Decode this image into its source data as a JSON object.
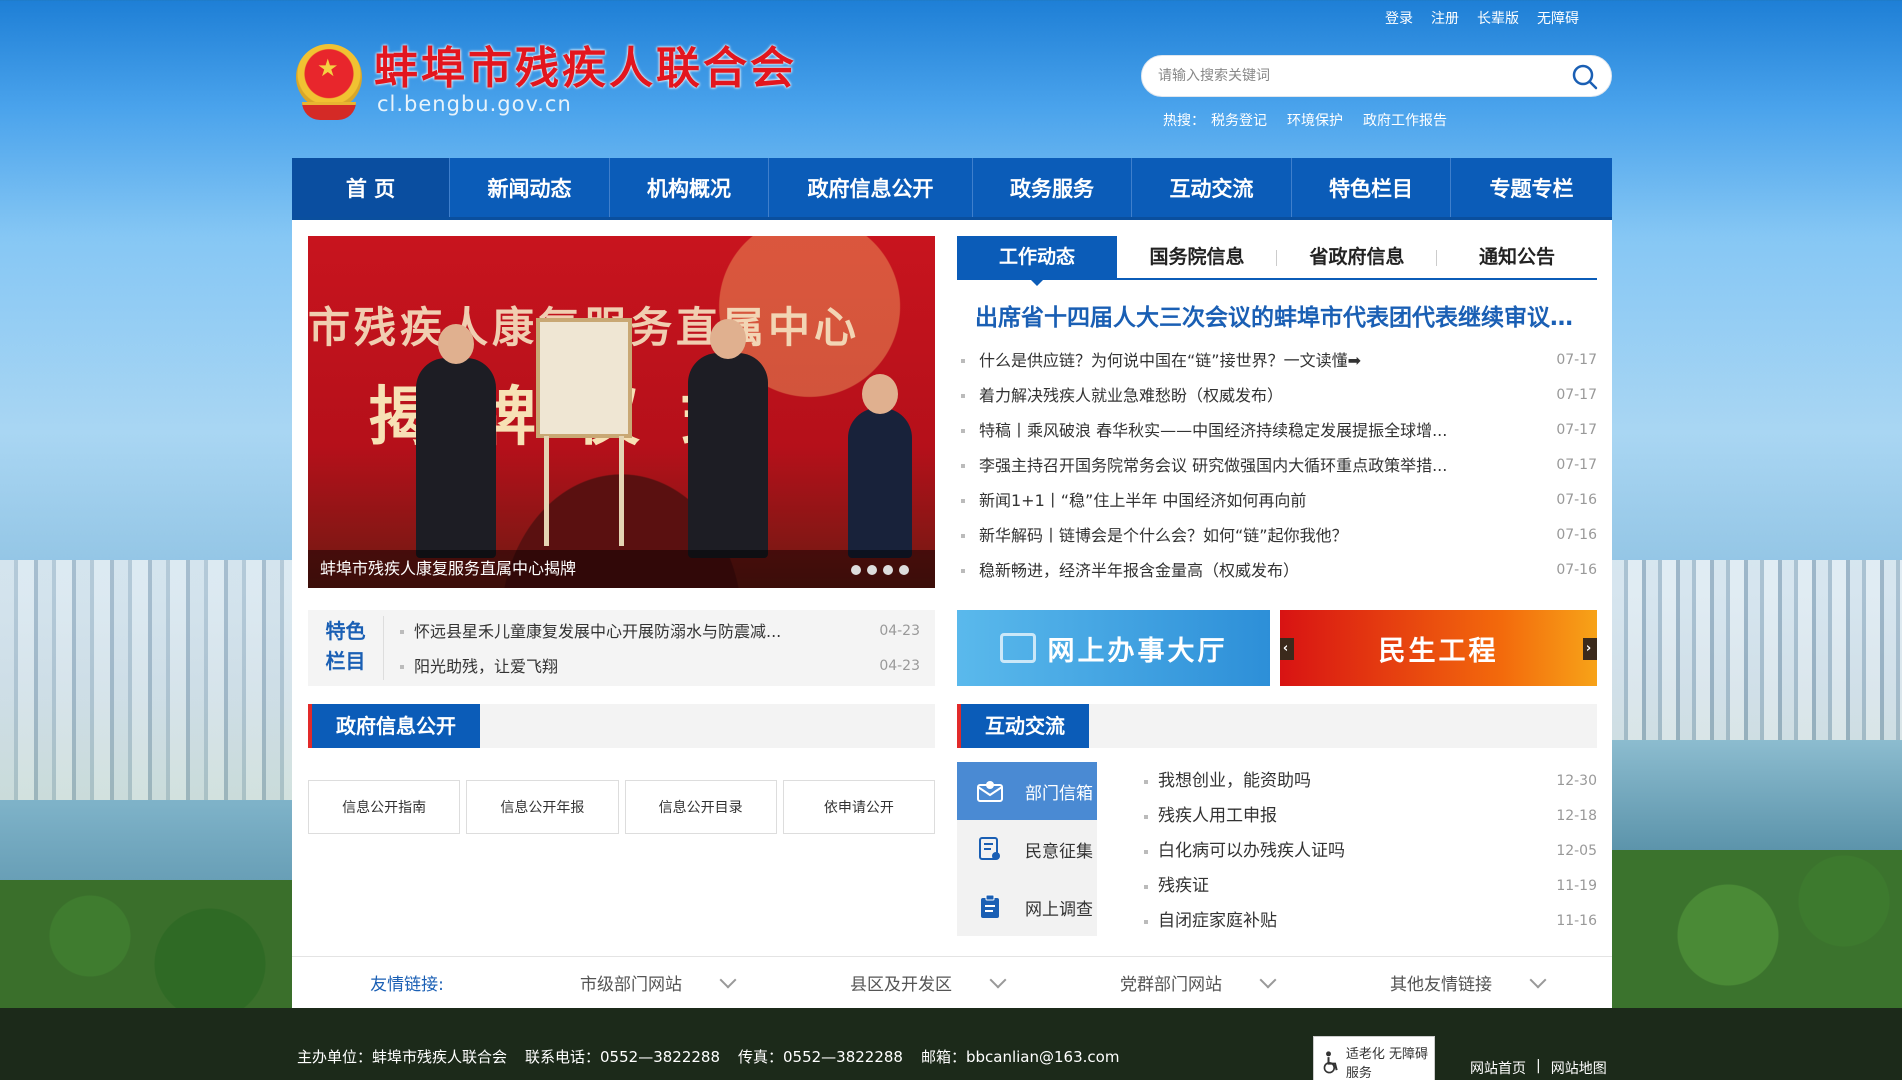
{
  "top_links": [
    "登录",
    "注册",
    "长辈版",
    "无障碍"
  ],
  "header": {
    "title": "蚌埠市残疾人联合会",
    "domain": "cl.bengbu.gov.cn"
  },
  "search": {
    "placeholder": "请输入搜索关键词",
    "hot_label": "热搜：",
    "hot_items": [
      "税务登记",
      "环境保护",
      "政府工作报告"
    ]
  },
  "nav": [
    "首 页",
    "新闻动态",
    "机构概况",
    "政府信息公开",
    "政务服务",
    "互动交流",
    "特色栏目",
    "专题专栏"
  ],
  "slider": {
    "banner_text_1": "市残疾人康复服务直属中心",
    "banner_text_2": "揭牌仪式",
    "caption": "蚌埠市残疾人康复服务直属中心揭牌",
    "dots": 4
  },
  "feature": {
    "label": "特色栏目",
    "label_line1": "特色",
    "label_line2": "栏目",
    "items": [
      {
        "title": "怀远县星禾儿童康复发展中心开展防溺水与防震减...",
        "date": "04-23"
      },
      {
        "title": "阳光助残，让爱飞翔",
        "date": "04-23"
      }
    ]
  },
  "gov_info": {
    "title": "政府信息公开",
    "buttons": [
      "信息公开指南",
      "信息公开年报",
      "信息公开目录",
      "依申请公开"
    ]
  },
  "news": {
    "tabs": [
      "工作动态",
      "国务院信息",
      "省政府信息",
      "通知公告"
    ],
    "headline": "出席省十四届人大三次会议的蚌埠市代表团代表继续审议政府工作报告",
    "items": [
      {
        "title": "什么是供应链？为何说中国在“链”接世界？一文读懂➡",
        "date": "07-17"
      },
      {
        "title": "着力解决残疾人就业急难愁盼（权威发布）",
        "date": "07-17"
      },
      {
        "title": "特稿丨乘风破浪 春华秋实——中国经济持续稳定发展提振全球增...",
        "date": "07-17"
      },
      {
        "title": "李强主持召开国务院常务会议 研究做强国内大循环重点政策举措...",
        "date": "07-17"
      },
      {
        "title": "新闻1+1丨“稳”住上半年 中国经济如何再向前",
        "date": "07-16"
      },
      {
        "title": "新华解码丨链博会是个什么会？如何“链”起你我他？",
        "date": "07-16"
      },
      {
        "title": "稳新畅进，经济半年报含金量高（权威发布）",
        "date": "07-16"
      }
    ]
  },
  "banners": {
    "blue": "网上办事大厅",
    "red": "民生工程"
  },
  "interaction": {
    "title": "互动交流",
    "menu": [
      "部门信箱",
      "民意征集",
      "网上调查"
    ],
    "items": [
      {
        "title": "我想创业，能资助吗",
        "date": "12-30"
      },
      {
        "title": "残疾人用工申报",
        "date": "12-18"
      },
      {
        "title": "白化病可以办残疾人证吗",
        "date": "12-05"
      },
      {
        "title": "残疾证",
        "date": "11-19"
      },
      {
        "title": "自闭症家庭补贴",
        "date": "11-16"
      }
    ]
  },
  "friendly_links": {
    "label": "友情链接:",
    "selects": [
      "市级部门网站",
      "县区及开发区",
      "党群部门网站",
      "其他友情链接"
    ]
  },
  "footer": {
    "sponsor": "主办单位：蚌埠市残疾人联合会",
    "phone": "联系电话：0552—3822288",
    "fax": "传真：0552—3822288",
    "email": "邮箱：bbcanlian@163.com",
    "badge": "适老化 无障碍服务",
    "links": [
      "网站首页",
      "网站地图"
    ]
  },
  "colors": {
    "nav_blue": "#0b5cb8",
    "title_red": "#e3161e",
    "accent_red": "#e22a2a"
  }
}
